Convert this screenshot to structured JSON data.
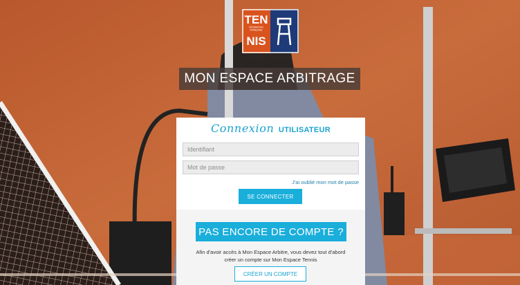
{
  "logo": {
    "line1": "TEN",
    "line2": "NIS",
    "federation_line1": "FÉDÉRATION",
    "federation_line2": "FRANÇAISE",
    "subtitle": "ARBITRAGE"
  },
  "page": {
    "title": "MON ESPACE ARBITRAGE"
  },
  "login": {
    "title_script": "Connexion",
    "title_caps": "UTILISATEUR",
    "username_placeholder": "Identifiant",
    "password_placeholder": "Mot de passe",
    "forgot_link": "J'ai oublié mon mot de passe",
    "submit_label": "SE CONNECTER"
  },
  "signup": {
    "heading_button": "PAS ENCORE DE COMPTE ?",
    "info_line1": "Afin d'avoir accès à Mon Espace Arbitre, vous devez tout d'abord",
    "info_line2": "créer un compte sur Mon Espace Tennis",
    "create_button": "CRÉER UN COMPTE"
  },
  "colors": {
    "accent": "#1aaedb",
    "logo_orange": "#d9531e",
    "logo_navy": "#1e3a78",
    "clay": "#c2653a"
  }
}
